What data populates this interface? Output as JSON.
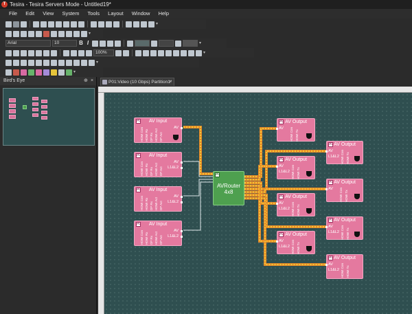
{
  "window": {
    "title": "Tesira - Tesira Servers Mode - Untitled19*"
  },
  "menu": [
    "File",
    "Edit",
    "View",
    "System",
    "Tools",
    "Layout",
    "Window",
    "Help"
  ],
  "format_toolbar": {
    "font": "Arial",
    "size": "10",
    "bold": "B",
    "italic": "I",
    "zoom": "100%"
  },
  "birds_eye": {
    "title": "Bird's Eye",
    "pin": "⊕",
    "close": "×"
  },
  "doc_tab": {
    "label": "P01:Video (10 Gbps) Partition1*",
    "close": "×"
  },
  "blocks": {
    "av_input": {
      "title": "AV Input",
      "out_av": "AV",
      "out_l1l2": "L1&L2",
      "ports": [
        "HDMI Con",
        "HDMI Rx",
        "DP Rx",
        "HDMI Act",
        "DP Act"
      ]
    },
    "av_output": {
      "title": "AV Output",
      "in_av": "AV",
      "in_l1l2": "L1&L2",
      "ports": [
        "HDMI Con",
        "HDMI Tx"
      ]
    },
    "router": {
      "title": "AVRouter",
      "subtitle": "4x8"
    },
    "badge": "AV"
  },
  "colors": {
    "canvas_bg": "#2f4f50",
    "block_fill": "#e4799f",
    "router_fill": "#4ea04f",
    "wire_orange": "#e5892a",
    "wire_yellow": "#f2df3a"
  }
}
